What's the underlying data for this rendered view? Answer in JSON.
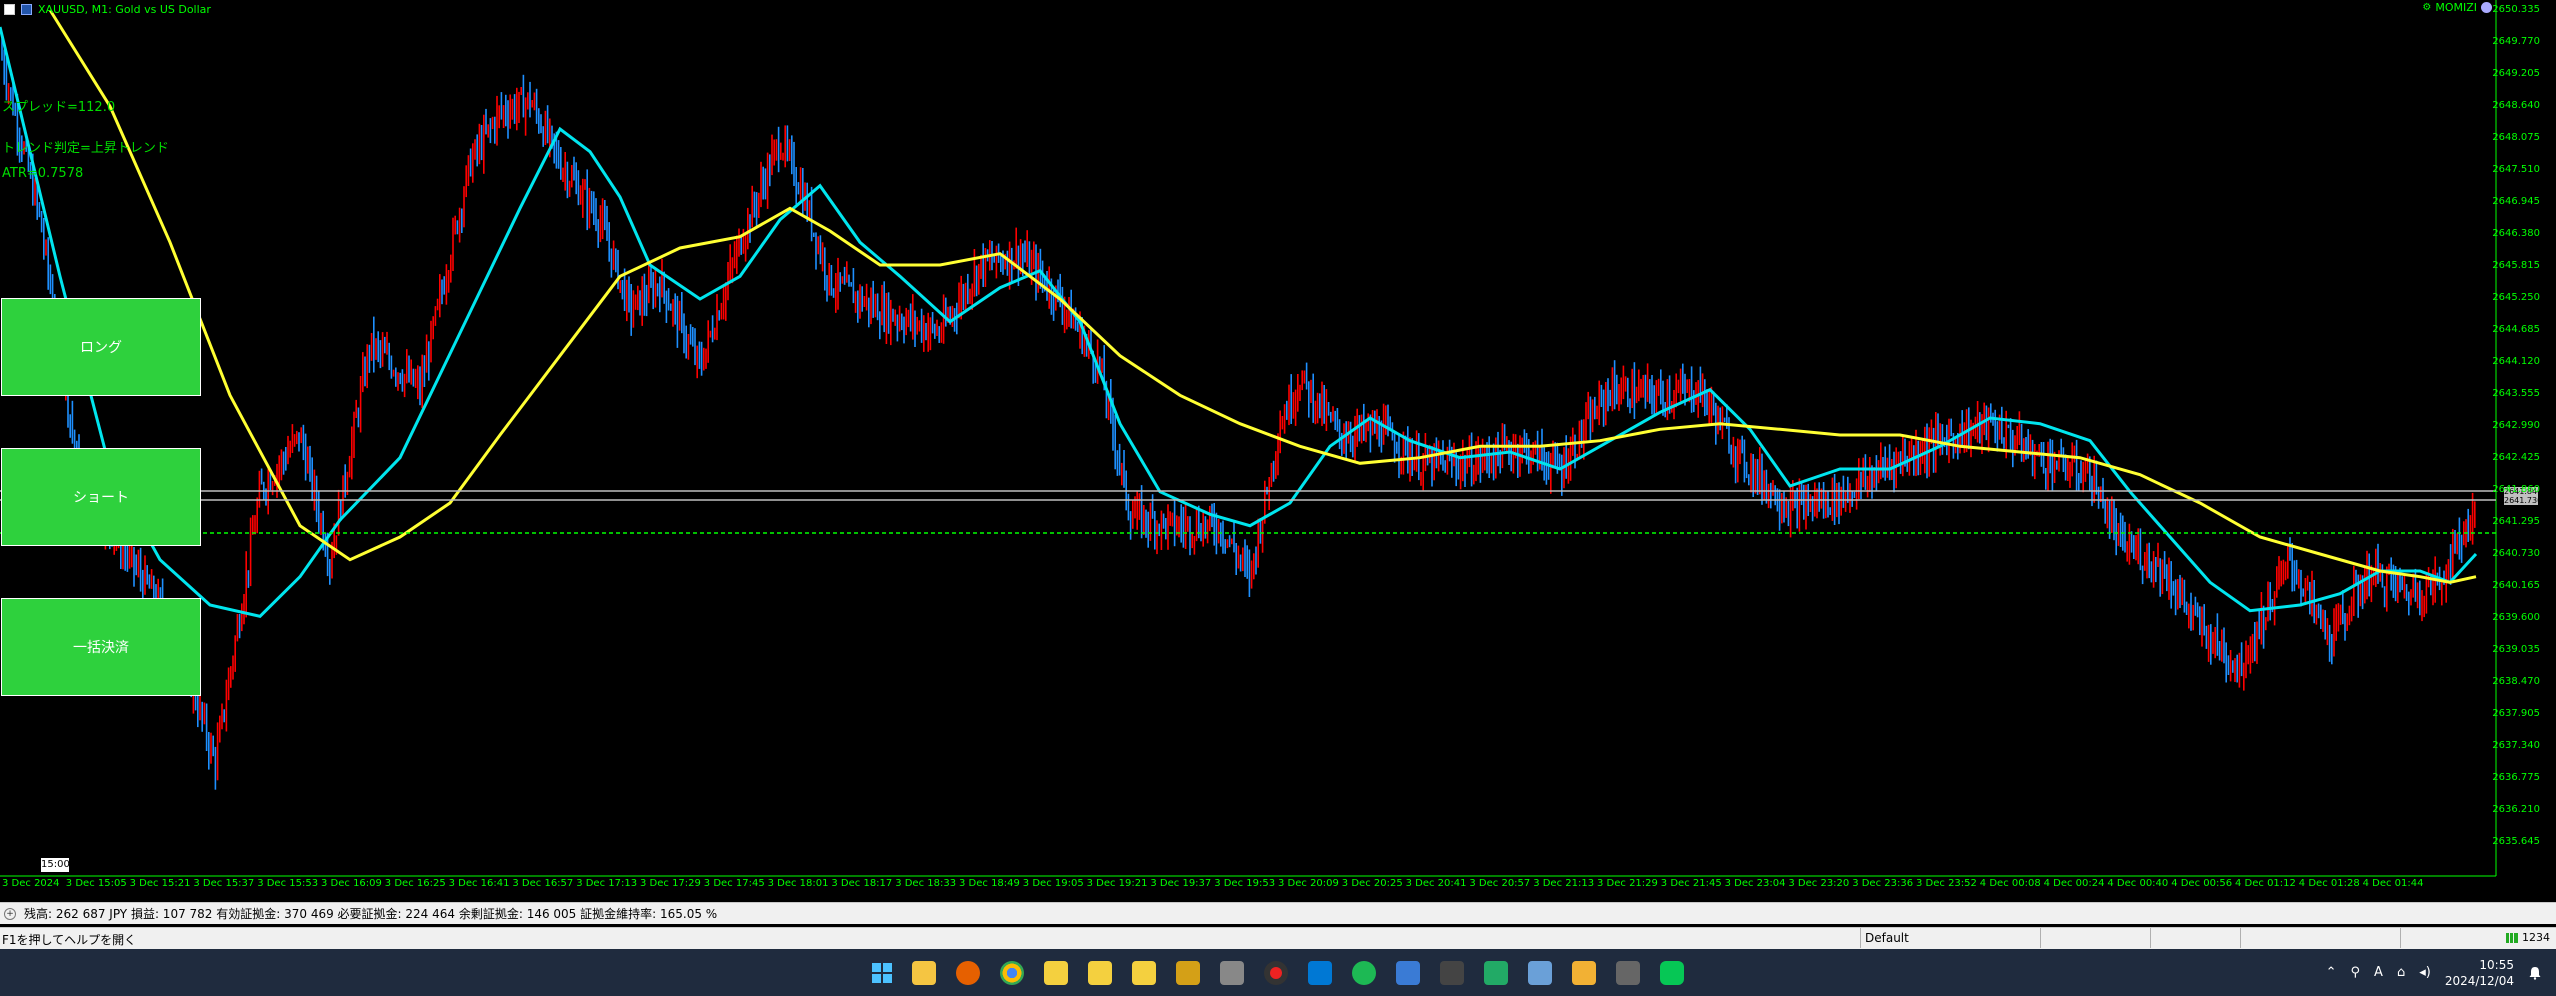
{
  "window": {
    "title": "XAUUSD, M1:  Gold vs US Dollar",
    "ea_name": "MOMIZI"
  },
  "indicators": {
    "spread": "スプレッド=112.0",
    "trend": "トレンド判定=上昇トレンド",
    "atr": "ATR=0.7578"
  },
  "trade_panel": {
    "long_label": "ロング",
    "short_label": "ショート",
    "close_all_label": "一括決済"
  },
  "price_axis": {
    "ticks": [
      "2650.335",
      "2649.770",
      "2649.205",
      "2648.640",
      "2648.075",
      "2647.510",
      "2646.945",
      "2646.380",
      "2645.815",
      "2645.250",
      "2644.685",
      "2644.120",
      "2643.555",
      "2642.990",
      "2642.425",
      "2641.860",
      "2641.295",
      "2640.730",
      "2640.165",
      "2639.600",
      "2639.035",
      "2638.470",
      "2637.905",
      "2637.340",
      "2636.775",
      "2636.210",
      "2635.645"
    ],
    "ask_tag": "2641.840",
    "bid_tag": "2641.730"
  },
  "time_axis": {
    "badge": "15:00",
    "labels": [
      "3 Dec 2024",
      "3 Dec 15:05",
      "3 Dec 15:21",
      "3 Dec 15:37",
      "3 Dec 15:53",
      "3 Dec 16:09",
      "3 Dec 16:25",
      "3 Dec 16:41",
      "3 Dec 16:57",
      "3 Dec 17:13",
      "3 Dec 17:29",
      "3 Dec 17:45",
      "3 Dec 18:01",
      "3 Dec 18:17",
      "3 Dec 18:33",
      "3 Dec 18:49",
      "3 Dec 19:05",
      "3 Dec 19:21",
      "3 Dec 19:37",
      "3 Dec 19:53",
      "3 Dec 20:09",
      "3 Dec 20:25",
      "3 Dec 20:41",
      "3 Dec 20:57",
      "3 Dec 21:13",
      "3 Dec 21:29",
      "3 Dec 21:45",
      "3 Dec 23:04",
      "3 Dec 23:20",
      "3 Dec 23:36",
      "3 Dec 23:52",
      "4 Dec 00:08",
      "4 Dec 00:24",
      "4 Dec 00:40",
      "4 Dec 00:56",
      "4 Dec 01:12",
      "4 Dec 01:28",
      "4 Dec 01:44"
    ]
  },
  "account": {
    "summary": "残高: 262 687 JPY  損益: 107 782  有効証拠金: 370 469  必要証拠金: 224 464  余剰証拠金: 146 005  証拠金維持率: 165.05 %"
  },
  "status": {
    "help": "F1を押してヘルプを開く",
    "profile": "Default",
    "ping": "1234"
  },
  "taskbar": {
    "time": "10:55",
    "date": "2024/12/04",
    "ime": "A"
  },
  "colors": {
    "bull": "#ff0000",
    "bear": "#1e90ff",
    "ma_fast": "#00e5ee",
    "ma_slow": "#ffff33",
    "grid_text": "#00ff00",
    "button": "#2ed13d"
  }
}
